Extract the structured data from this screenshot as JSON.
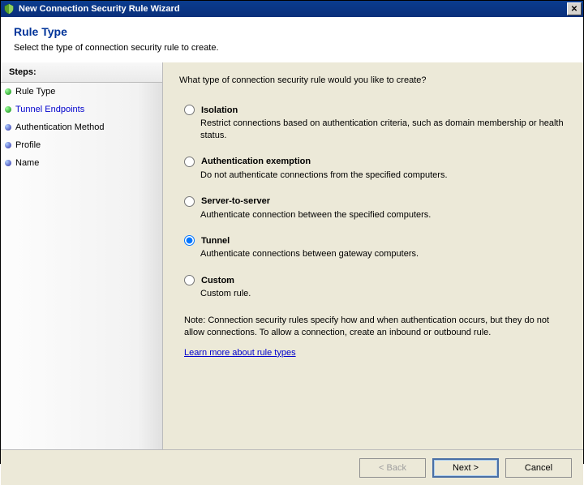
{
  "window": {
    "title": "New Connection Security Rule Wizard",
    "close_label": "✕"
  },
  "header": {
    "title": "Rule Type",
    "subtitle": "Select the type of connection security rule to create."
  },
  "sidebar": {
    "header": "Steps:",
    "items": [
      {
        "label": "Rule Type",
        "current": true,
        "color": "green"
      },
      {
        "label": "Tunnel Endpoints",
        "current": false,
        "color": "green",
        "link": true
      },
      {
        "label": "Authentication Method",
        "current": false,
        "color": "blue"
      },
      {
        "label": "Profile",
        "current": false,
        "color": "blue"
      },
      {
        "label": "Name",
        "current": false,
        "color": "blue"
      }
    ]
  },
  "main": {
    "question": "What type of connection security rule would you like to create?",
    "options": [
      {
        "value": "isolation",
        "label": "Isolation",
        "desc": "Restrict connections based on authentication criteria, such as domain membership or health status."
      },
      {
        "value": "authexemption",
        "label": "Authentication exemption",
        "desc": "Do not authenticate connections from the specified computers."
      },
      {
        "value": "servertoserver",
        "label": "Server-to-server",
        "desc": "Authenticate connection between the specified computers."
      },
      {
        "value": "tunnel",
        "label": "Tunnel",
        "desc": "Authenticate connections between gateway computers."
      },
      {
        "value": "custom",
        "label": "Custom",
        "desc": "Custom rule."
      }
    ],
    "selected": "tunnel",
    "note": "Note:  Connection security rules specify how and when authentication occurs, but they do not allow connections.  To allow a connection, create an inbound or outbound rule.",
    "learn_more": "Learn more about rule types"
  },
  "buttons": {
    "back": "< Back",
    "next": "Next >",
    "cancel": "Cancel"
  }
}
